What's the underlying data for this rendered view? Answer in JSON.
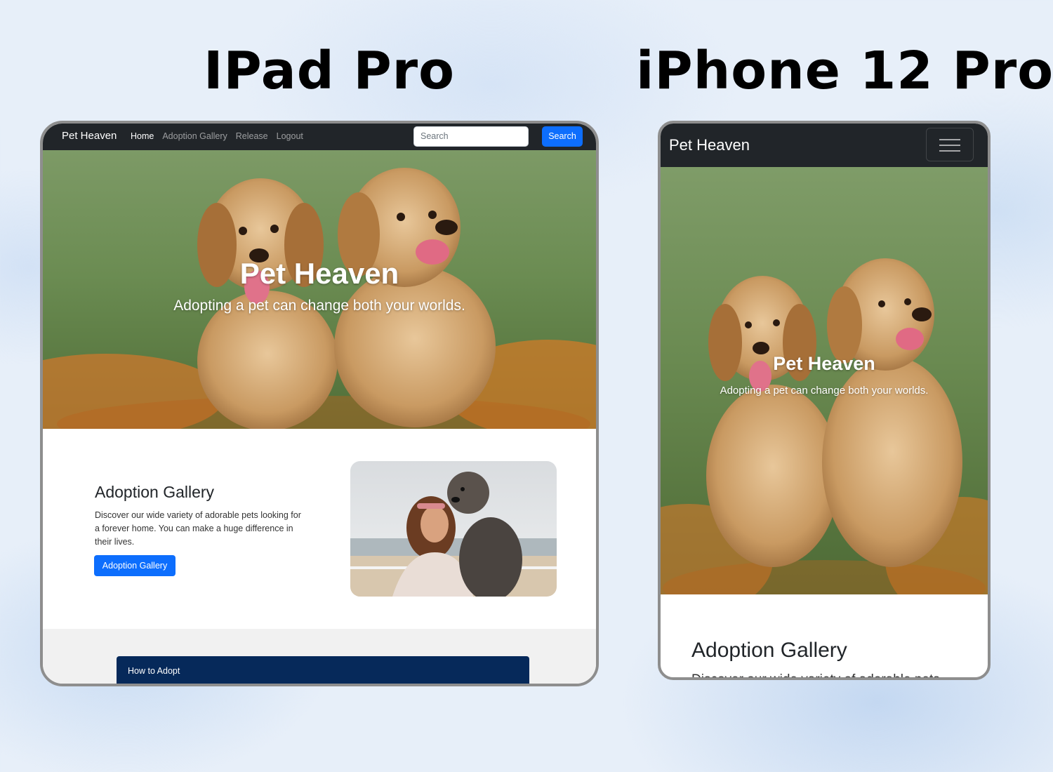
{
  "devices": {
    "ipad_title": "IPad Pro",
    "iphone_title": "iPhone 12 Pro"
  },
  "site": {
    "brand": "Pet Heaven",
    "nav": {
      "home": "Home",
      "adoption_gallery": "Adoption Gallery",
      "release": "Release",
      "logout": "Logout"
    },
    "search": {
      "placeholder": "Search",
      "button_label": "Search"
    },
    "hero": {
      "title": "Pet Heaven",
      "subtitle": "Adopting a pet can change both your worlds."
    },
    "gallery": {
      "title": "Adoption Gallery",
      "description": "Discover our wide variety of adorable pets looking for a forever home. You can make a huge difference in their lives.",
      "mobile_description_visible": "Discover our wide variety of adorable pets",
      "button_label": "Adoption Gallery"
    },
    "how_to_adopt": {
      "title": "How to Adopt"
    }
  },
  "colors": {
    "navbar": "#212529",
    "primary": "#0d6efd",
    "card_header": "#06295a"
  }
}
